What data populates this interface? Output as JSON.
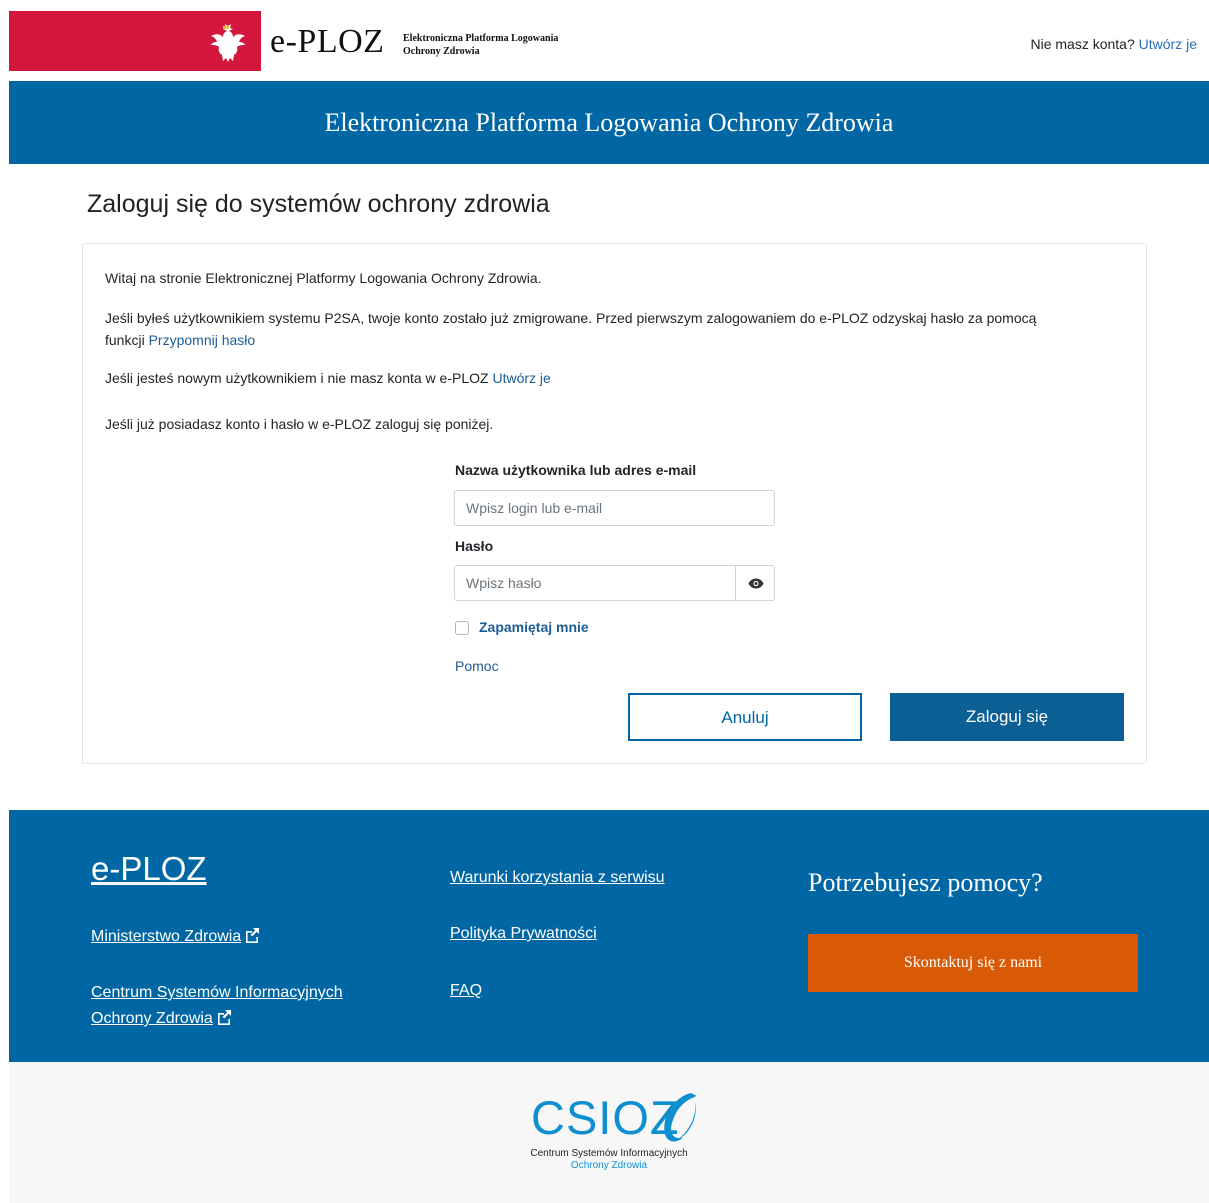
{
  "header": {
    "brand": "e-PLOZ",
    "brand_sub_line1": "Elektroniczna Platforma Logowania",
    "brand_sub_line2": "Ochrony Zdrowia",
    "no_account_text": "Nie masz konta?",
    "create_account_link": "Utwórz je",
    "banner_title": "Elektroniczna Platforma Logowania Ochrony Zdrowia",
    "brand_color": "#d3173d",
    "banner_color": "#0067a4"
  },
  "main": {
    "page_title": "Zaloguj się do systemów ochrony zdrowia",
    "welcome": "Witaj na stronie Elektronicznej Platformy Logowania Ochrony Zdrowia.",
    "p2sa_text_line1": "Jeśli byłeś użytkownikiem systemu P2SA, twoje konto zostało już zmigrowane. Przed pierwszym zalogowaniem do e-PLOZ odzyskaj hasło za pomocą",
    "p2sa_text_line2_prefix": "funkcji",
    "recover_password_link": "Przypomnij hasło",
    "new_user_text": "Jeśli jesteś nowym użytkownikiem i nie masz konta w e-PLOZ",
    "new_user_link": "Utwórz je",
    "existing_text": "Jeśli już posiadasz konto i hasło w e-PLOZ zaloguj się poniżej.",
    "form": {
      "username_label": "Nazwa użytkownika lub adres e-mail",
      "username_placeholder": "Wpisz login lub e-mail",
      "password_label": "Hasło",
      "password_placeholder": "Wpisz hasło",
      "remember_label": "Zapamiętaj mnie",
      "help_link": "Pomoc",
      "cancel_button": "Anuluj",
      "login_button": "Zaloguj się"
    }
  },
  "footer": {
    "brand": "e-PLOZ",
    "link_ministry": "Ministerstwo Zdrowia",
    "link_csioz_line1": "Centrum Systemów Informacyjnych",
    "link_csioz_line2": "Ochrony Zdrowia",
    "link_terms": "Warunki korzystania z serwisu",
    "link_privacy": "Polityka Prywatności",
    "link_faq": "FAQ",
    "help_title": "Potrzebujesz pomocy?",
    "contact_button": "Skontaktuj się z nami",
    "contact_color": "#d85a06"
  },
  "logo": {
    "name": "CSIOZ",
    "sub_line1": "Centrum Systemów Informacyjnych",
    "sub_line2": "Ochrony Zdrowia"
  }
}
